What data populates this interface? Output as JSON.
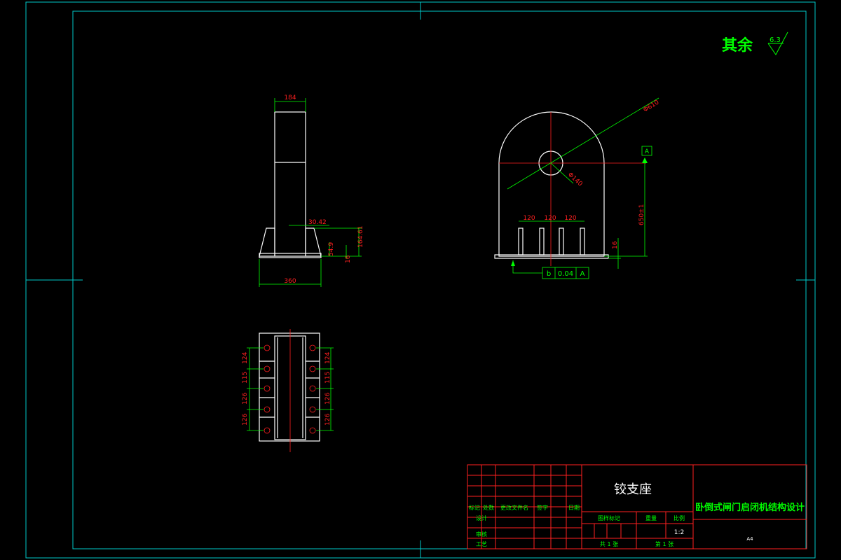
{
  "roughness": {
    "label": "其余",
    "value": "6.3"
  },
  "side_view": {
    "top_width": "184",
    "gusset_offset": "30.42",
    "gusset_height": "164.61",
    "base_small_dim": "54.9",
    "base_thickness": "16",
    "base_width": "360"
  },
  "front_view": {
    "outer_radius": "Φ610",
    "hole_diameter": "Φ140",
    "rib_spacing": [
      "120",
      "120",
      "120"
    ],
    "base_thickness": "16",
    "center_height": "650±1",
    "datum": "A",
    "tolerance": {
      "symbol": "b",
      "value": "0.04",
      "datum": "A"
    }
  },
  "plan_view": {
    "left_dims": [
      "124",
      "115",
      "126",
      "126"
    ],
    "right_dims": [
      "124",
      "115",
      "126",
      "126"
    ]
  },
  "title_block": {
    "part_name": "铰支座",
    "project_name": "卧倒式闸门启闭机结构设计",
    "marks_row": [
      "标记",
      "处数",
      "更改文件名",
      "签字",
      "日期"
    ],
    "design": "设计",
    "review": "审核",
    "process": "工艺",
    "stage_mark": "图样标记",
    "weight": "重量",
    "scale_label": "比例",
    "scale": "1:2",
    "sheets_total": "共 1 张",
    "sheet_no": "第 1 张",
    "paper_size": "A4"
  },
  "colors": {
    "frame": "#00c8c8",
    "geometry": "#ffffff",
    "dimension": "#00ff00",
    "centerline": "#ff2020",
    "titleblock": "#ff2020",
    "text": "#ffffff",
    "hole": "#ff3030"
  }
}
